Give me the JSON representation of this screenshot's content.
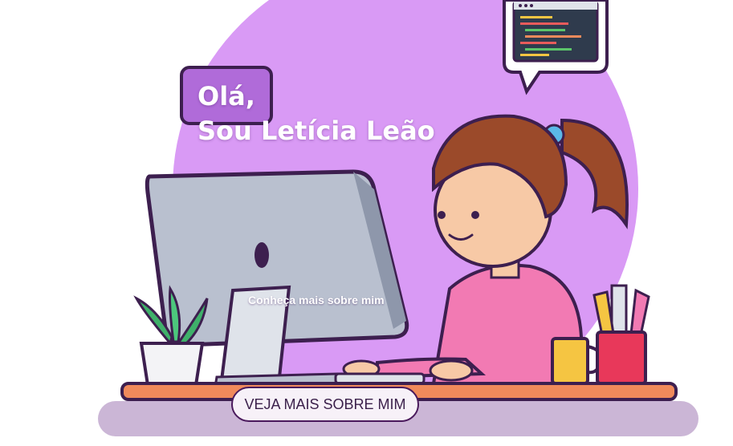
{
  "hero": {
    "greeting": "Olá,",
    "name": "Sou Letícia Leão",
    "subtitle": "Conheça mais sobre mim",
    "cta_label": "VEJA MAIS SOBRE MIM"
  },
  "colors": {
    "circle": "#d99af5",
    "bubble_purple": "#b06bd9",
    "outline": "#3d1f4f",
    "shirt": "#f27ab3",
    "hair": "#9b4a2a",
    "desk": "#f08a5b",
    "monitor": "#b9c0cf",
    "text": "#ffffff",
    "button_bg": "#f7f1f8"
  },
  "icons": {
    "speech_bubble": "code-window-bubble-icon",
    "greeting_bubble": "greeting-bubble-icon",
    "plant": "plant-icon",
    "mug": "mug-icon",
    "pencil_cup": "pencil-cup-icon"
  }
}
